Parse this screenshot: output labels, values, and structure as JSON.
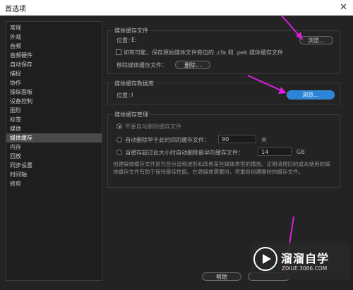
{
  "window": {
    "title": "首选项",
    "close": "✕"
  },
  "sidebar": {
    "items": [
      {
        "label": "常规"
      },
      {
        "label": "外观"
      },
      {
        "label": "音频"
      },
      {
        "label": "音频硬件"
      },
      {
        "label": "自动保存"
      },
      {
        "label": "捕捉"
      },
      {
        "label": "协作"
      },
      {
        "label": "操纵面板"
      },
      {
        "label": "设备控制"
      },
      {
        "label": "图形"
      },
      {
        "label": "标签"
      },
      {
        "label": "媒体"
      },
      {
        "label": "媒体缓存",
        "selected": true
      },
      {
        "label": "内存"
      },
      {
        "label": "回放"
      },
      {
        "label": "同步设置"
      },
      {
        "label": "时间轴"
      },
      {
        "label": "修剪"
      }
    ]
  },
  "media_cache_files": {
    "title": "媒体缓存文件",
    "location_label": "位置：",
    "location_value": "E:",
    "browse": "浏览...",
    "save_beside_checkbox": "如有可能，保存原始媒体文件旁边的 .cfa 和 .pek 媒体缓存文件",
    "remove_label": "移除媒体缓存文件：",
    "delete": "删除..."
  },
  "media_cache_database": {
    "title": "媒体缓存数据库",
    "location_label": "位置：",
    "location_value": "I",
    "browse": "浏览..."
  },
  "media_cache_management": {
    "title": "媒体缓存管理",
    "option_none": "不要自动删除缓存文件",
    "option_older": "自动删除早于此时间的缓存文件：",
    "older_value": "90",
    "older_unit": "天",
    "option_size": "当缓存超过此大小时自动删除最早的缓存文件：",
    "size_value": "14",
    "size_unit": "GB",
    "description": "创建媒体缓存文件是为显示音频波形和改善某些媒体类型的播放。定期清理旧的或未使用的媒体缓存文件有助于保持最佳性能。在源媒体需要时，将重新创建删除的缓存文件。"
  },
  "footer": {
    "help": "帮助"
  },
  "watermark": {
    "name": "溜溜自学",
    "url": "ZIXUE.3066.COM"
  },
  "colors": {
    "accent": "#2c84d8",
    "annotation": "#d61fd6"
  }
}
